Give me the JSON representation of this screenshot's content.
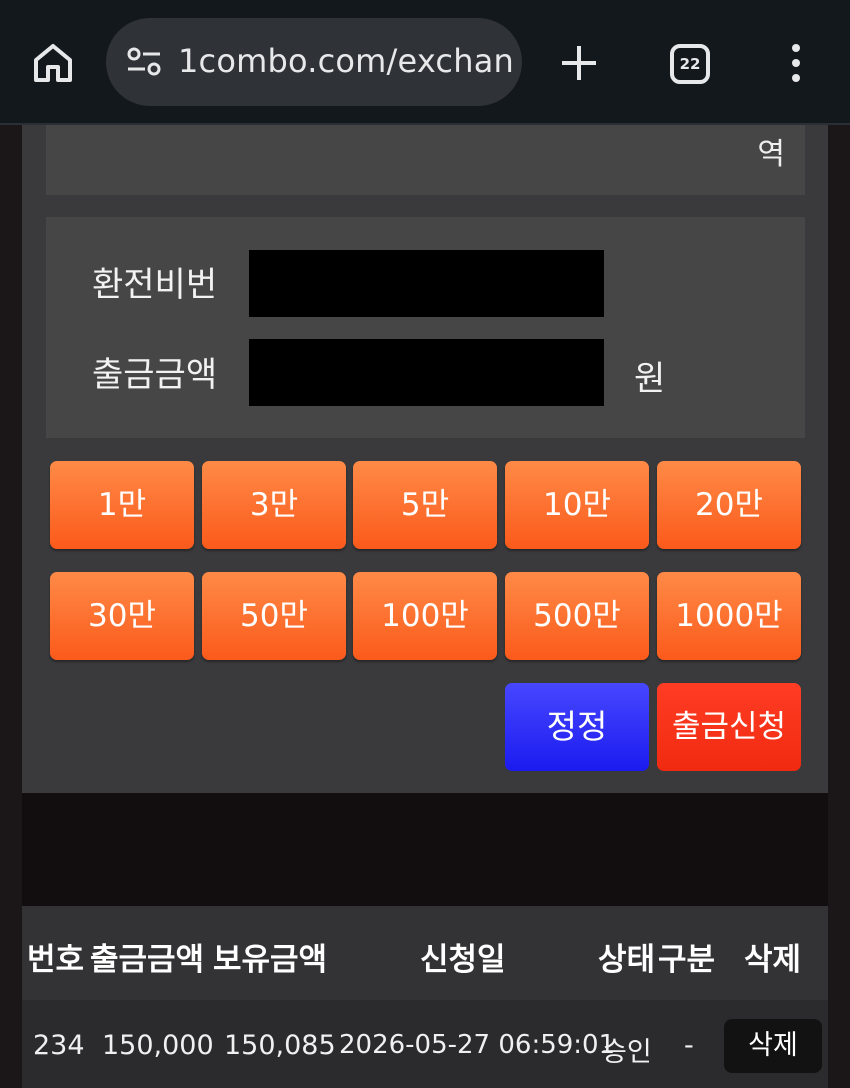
{
  "browser": {
    "url": "1combo.com/exchan",
    "tab_count": "22"
  },
  "top_card": {
    "text": "역"
  },
  "form": {
    "password_label": "환전비번",
    "amount_label": "출금금액",
    "amount_unit": "원",
    "password_value": "",
    "amount_value": ""
  },
  "amount_buttons": [
    "1만",
    "3만",
    "5만",
    "10만",
    "20만",
    "30만",
    "50만",
    "100만",
    "500만",
    "1000만"
  ],
  "actions": {
    "fix_label": "정정",
    "withdraw_label": "출금신청"
  },
  "table": {
    "headers": {
      "no": "번호",
      "amount": "출금금액",
      "balance": "보유금액",
      "date": "신청일",
      "status": "상태",
      "type": "구분",
      "delete": "삭제"
    },
    "rows": [
      {
        "no": "234",
        "amount": "150,000",
        "balance": "150,085",
        "date": "2026-05-27 06:59:01",
        "status": "승인",
        "type": "-",
        "delete_label": "삭제"
      }
    ]
  },
  "colors": {
    "amount_button": "#fb6a2a",
    "fix_button": "#2a2af5",
    "withdraw_button": "#f5301a",
    "panel": "#3a3a3c"
  }
}
